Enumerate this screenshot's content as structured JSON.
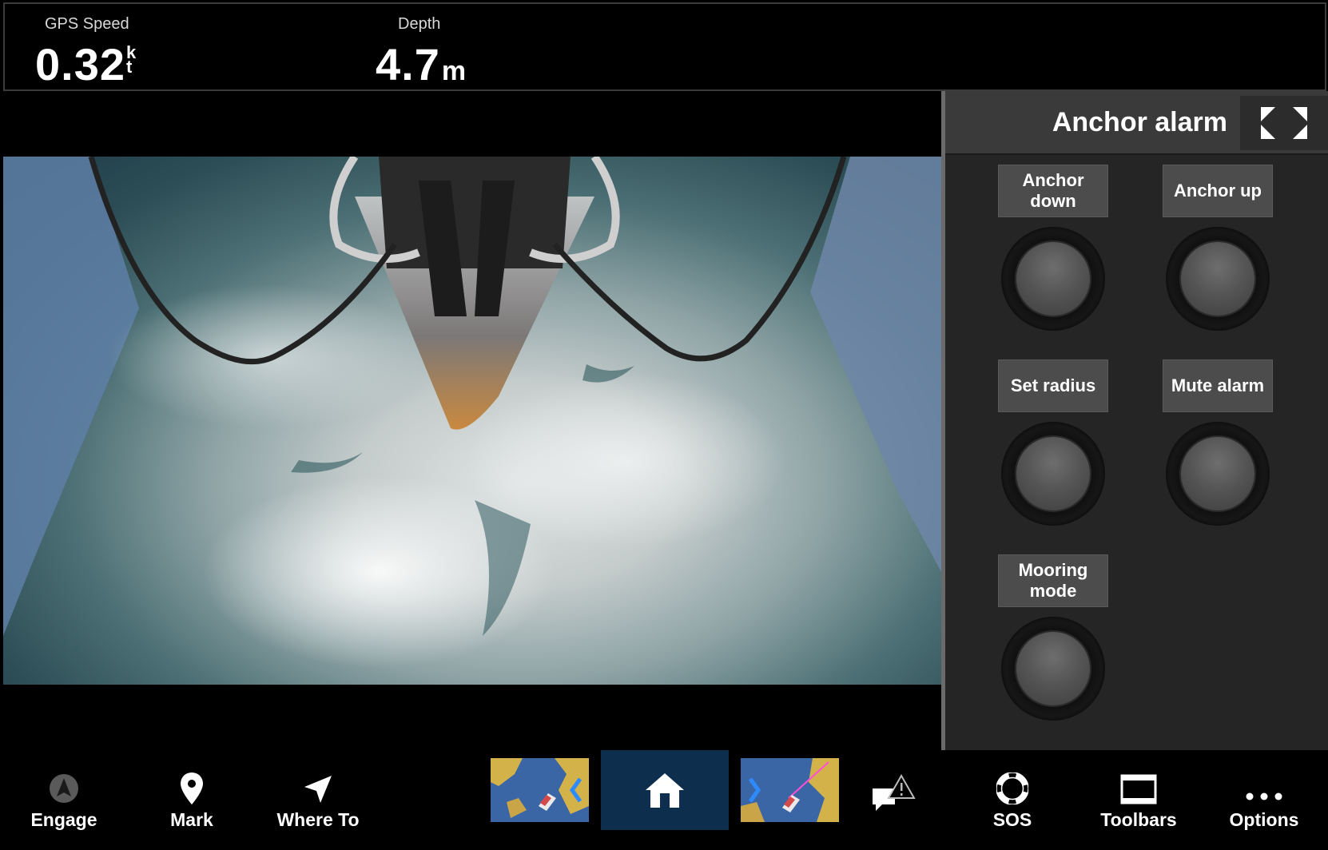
{
  "databar": {
    "gps_speed": {
      "label": "GPS Speed",
      "value": "0.32",
      "unit_top": "k",
      "unit_bottom": "t"
    },
    "depth": {
      "label": "Depth",
      "value": "4.7",
      "unit": "m"
    }
  },
  "camera": {
    "description_icon": "camera-feed"
  },
  "anchor_panel": {
    "title": "Anchor alarm",
    "expand_icon": "expand-icon",
    "controls": [
      {
        "label": "Anchor down"
      },
      {
        "label": "Anchor up"
      },
      {
        "label": "Set radius"
      },
      {
        "label": "Mute alarm"
      },
      {
        "label": "Mooring mode"
      }
    ]
  },
  "toolbar": {
    "engage": {
      "label": "Engage",
      "icon": "autopilot-icon"
    },
    "mark": {
      "label": "Mark",
      "icon": "map-pin-icon"
    },
    "where_to": {
      "label": "Where To",
      "icon": "navigate-arrow-icon"
    },
    "prev_app": {
      "icon": "chart-thumbnail-prev"
    },
    "home": {
      "icon": "home-icon"
    },
    "next_app": {
      "icon": "chart-thumbnail-next"
    },
    "alerts": {
      "icon": "alert-message-icon"
    },
    "sos": {
      "label": "SOS",
      "icon": "lifebuoy-icon"
    },
    "toolbars": {
      "label": "Toolbars",
      "icon": "toolbar-window-icon"
    },
    "options": {
      "label": "Options",
      "icon": "more-dots-icon"
    }
  },
  "colors": {
    "accent_home": "#0e2e4e",
    "panel_bg": "#252525",
    "button_bg": "#4c4c4c"
  }
}
